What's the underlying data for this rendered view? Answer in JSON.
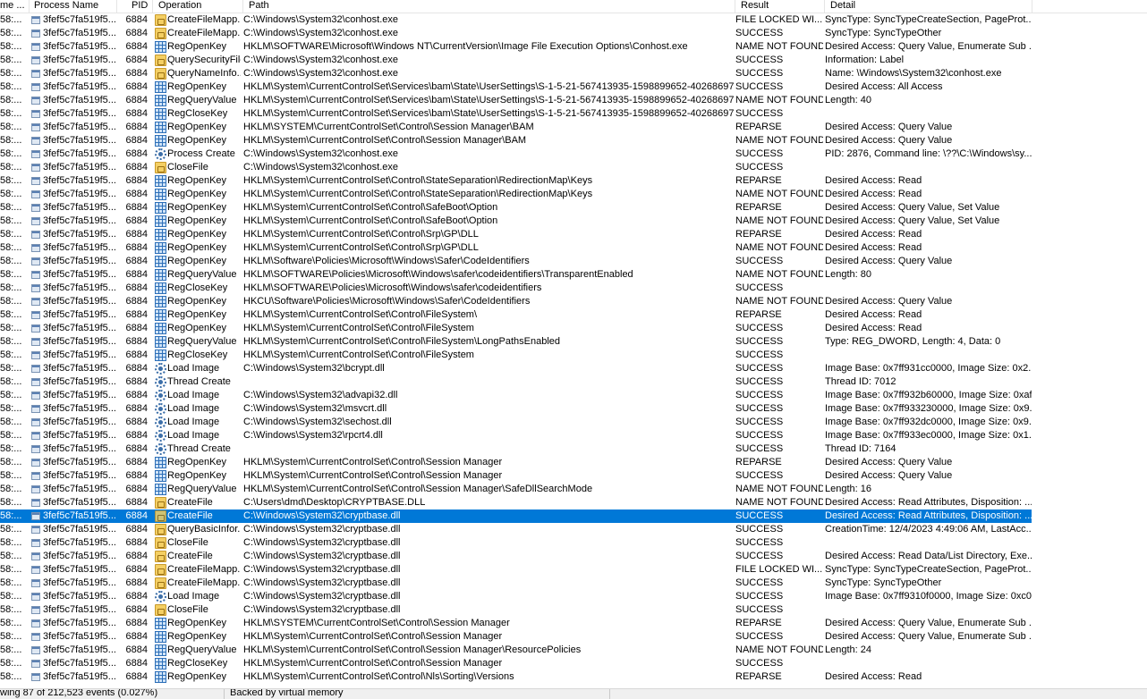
{
  "columns": {
    "time": "me ...",
    "process": "Process Name",
    "pid": "PID",
    "operation": "Operation",
    "path": "Path",
    "result": "Result",
    "detail": "Detail"
  },
  "rows": [
    {
      "time": "58:...",
      "process": "3fef5c7fa519f5...",
      "pid": "6884",
      "op_icon": "file-icon",
      "operation": "CreateFileMapp...",
      "path": "C:\\Windows\\System32\\conhost.exe",
      "result": "FILE LOCKED WI...",
      "detail": "SyncType: SyncTypeCreateSection, PageProt..."
    },
    {
      "time": "58:...",
      "process": "3fef5c7fa519f5...",
      "pid": "6884",
      "op_icon": "file-icon",
      "operation": "CreateFileMapp...",
      "path": "C:\\Windows\\System32\\conhost.exe",
      "result": "SUCCESS",
      "detail": "SyncType: SyncTypeOther"
    },
    {
      "time": "58:...",
      "process": "3fef5c7fa519f5...",
      "pid": "6884",
      "op_icon": "registry-icon",
      "operation": "RegOpenKey",
      "path": "HKLM\\SOFTWARE\\Microsoft\\Windows NT\\CurrentVersion\\Image File Execution Options\\Conhost.exe",
      "result": "NAME NOT FOUND",
      "detail": "Desired Access: Query Value, Enumerate Sub ..."
    },
    {
      "time": "58:...",
      "process": "3fef5c7fa519f5...",
      "pid": "6884",
      "op_icon": "file-icon",
      "operation": "QuerySecurityFile",
      "path": "C:\\Windows\\System32\\conhost.exe",
      "result": "SUCCESS",
      "detail": "Information: Label"
    },
    {
      "time": "58:...",
      "process": "3fef5c7fa519f5...",
      "pid": "6884",
      "op_icon": "file-icon",
      "operation": "QueryNameInfo...",
      "path": "C:\\Windows\\System32\\conhost.exe",
      "result": "SUCCESS",
      "detail": "Name: \\Windows\\System32\\conhost.exe"
    },
    {
      "time": "58:...",
      "process": "3fef5c7fa519f5...",
      "pid": "6884",
      "op_icon": "registry-icon",
      "operation": "RegOpenKey",
      "path": "HKLM\\System\\CurrentControlSet\\Services\\bam\\State\\UserSettings\\S-1-5-21-567413935-1598899652-40268697...",
      "result": "SUCCESS",
      "detail": "Desired Access: All Access"
    },
    {
      "time": "58:...",
      "process": "3fef5c7fa519f5...",
      "pid": "6884",
      "op_icon": "registry-icon",
      "operation": "RegQueryValue",
      "path": "HKLM\\System\\CurrentControlSet\\Services\\bam\\State\\UserSettings\\S-1-5-21-567413935-1598899652-40268697...",
      "result": "NAME NOT FOUND",
      "detail": "Length: 40"
    },
    {
      "time": "58:...",
      "process": "3fef5c7fa519f5...",
      "pid": "6884",
      "op_icon": "registry-icon",
      "operation": "RegCloseKey",
      "path": "HKLM\\System\\CurrentControlSet\\Services\\bam\\State\\UserSettings\\S-1-5-21-567413935-1598899652-40268697...",
      "result": "SUCCESS",
      "detail": ""
    },
    {
      "time": "58:...",
      "process": "3fef5c7fa519f5...",
      "pid": "6884",
      "op_icon": "registry-icon",
      "operation": "RegOpenKey",
      "path": "HKLM\\SYSTEM\\CurrentControlSet\\Control\\Session Manager\\BAM",
      "result": "REPARSE",
      "detail": "Desired Access: Query Value"
    },
    {
      "time": "58:...",
      "process": "3fef5c7fa519f5...",
      "pid": "6884",
      "op_icon": "registry-icon",
      "operation": "RegOpenKey",
      "path": "HKLM\\System\\CurrentControlSet\\Control\\Session Manager\\BAM",
      "result": "NAME NOT FOUND",
      "detail": "Desired Access: Query Value"
    },
    {
      "time": "58:...",
      "process": "3fef5c7fa519f5...",
      "pid": "6884",
      "op_icon": "process-icon",
      "operation": "Process Create",
      "path": "C:\\Windows\\System32\\conhost.exe",
      "result": "SUCCESS",
      "detail": "PID: 2876, Command line: \\??\\C:\\Windows\\sy..."
    },
    {
      "time": "58:...",
      "process": "3fef5c7fa519f5...",
      "pid": "6884",
      "op_icon": "file-icon",
      "operation": "CloseFile",
      "path": "C:\\Windows\\System32\\conhost.exe",
      "result": "SUCCESS",
      "detail": ""
    },
    {
      "time": "58:...",
      "process": "3fef5c7fa519f5...",
      "pid": "6884",
      "op_icon": "registry-icon",
      "operation": "RegOpenKey",
      "path": "HKLM\\System\\CurrentControlSet\\Control\\StateSeparation\\RedirectionMap\\Keys",
      "result": "REPARSE",
      "detail": "Desired Access: Read"
    },
    {
      "time": "58:...",
      "process": "3fef5c7fa519f5...",
      "pid": "6884",
      "op_icon": "registry-icon",
      "operation": "RegOpenKey",
      "path": "HKLM\\System\\CurrentControlSet\\Control\\StateSeparation\\RedirectionMap\\Keys",
      "result": "NAME NOT FOUND",
      "detail": "Desired Access: Read"
    },
    {
      "time": "58:...",
      "process": "3fef5c7fa519f5...",
      "pid": "6884",
      "op_icon": "registry-icon",
      "operation": "RegOpenKey",
      "path": "HKLM\\System\\CurrentControlSet\\Control\\SafeBoot\\Option",
      "result": "REPARSE",
      "detail": "Desired Access: Query Value, Set Value"
    },
    {
      "time": "58:...",
      "process": "3fef5c7fa519f5...",
      "pid": "6884",
      "op_icon": "registry-icon",
      "operation": "RegOpenKey",
      "path": "HKLM\\System\\CurrentControlSet\\Control\\SafeBoot\\Option",
      "result": "NAME NOT FOUND",
      "detail": "Desired Access: Query Value, Set Value"
    },
    {
      "time": "58:...",
      "process": "3fef5c7fa519f5...",
      "pid": "6884",
      "op_icon": "registry-icon",
      "operation": "RegOpenKey",
      "path": "HKLM\\System\\CurrentControlSet\\Control\\Srp\\GP\\DLL",
      "result": "REPARSE",
      "detail": "Desired Access: Read"
    },
    {
      "time": "58:...",
      "process": "3fef5c7fa519f5...",
      "pid": "6884",
      "op_icon": "registry-icon",
      "operation": "RegOpenKey",
      "path": "HKLM\\System\\CurrentControlSet\\Control\\Srp\\GP\\DLL",
      "result": "NAME NOT FOUND",
      "detail": "Desired Access: Read"
    },
    {
      "time": "58:...",
      "process": "3fef5c7fa519f5...",
      "pid": "6884",
      "op_icon": "registry-icon",
      "operation": "RegOpenKey",
      "path": "HKLM\\Software\\Policies\\Microsoft\\Windows\\Safer\\CodeIdentifiers",
      "result": "SUCCESS",
      "detail": "Desired Access: Query Value"
    },
    {
      "time": "58:...",
      "process": "3fef5c7fa519f5...",
      "pid": "6884",
      "op_icon": "registry-icon",
      "operation": "RegQueryValue",
      "path": "HKLM\\SOFTWARE\\Policies\\Microsoft\\Windows\\safer\\codeidentifiers\\TransparentEnabled",
      "result": "NAME NOT FOUND",
      "detail": "Length: 80"
    },
    {
      "time": "58:...",
      "process": "3fef5c7fa519f5...",
      "pid": "6884",
      "op_icon": "registry-icon",
      "operation": "RegCloseKey",
      "path": "HKLM\\SOFTWARE\\Policies\\Microsoft\\Windows\\safer\\codeidentifiers",
      "result": "SUCCESS",
      "detail": ""
    },
    {
      "time": "58:...",
      "process": "3fef5c7fa519f5...",
      "pid": "6884",
      "op_icon": "registry-icon",
      "operation": "RegOpenKey",
      "path": "HKCU\\Software\\Policies\\Microsoft\\Windows\\Safer\\CodeIdentifiers",
      "result": "NAME NOT FOUND",
      "detail": "Desired Access: Query Value"
    },
    {
      "time": "58:...",
      "process": "3fef5c7fa519f5...",
      "pid": "6884",
      "op_icon": "registry-icon",
      "operation": "RegOpenKey",
      "path": "HKLM\\System\\CurrentControlSet\\Control\\FileSystem\\",
      "result": "REPARSE",
      "detail": "Desired Access: Read"
    },
    {
      "time": "58:...",
      "process": "3fef5c7fa519f5...",
      "pid": "6884",
      "op_icon": "registry-icon",
      "operation": "RegOpenKey",
      "path": "HKLM\\System\\CurrentControlSet\\Control\\FileSystem",
      "result": "SUCCESS",
      "detail": "Desired Access: Read"
    },
    {
      "time": "58:...",
      "process": "3fef5c7fa519f5...",
      "pid": "6884",
      "op_icon": "registry-icon",
      "operation": "RegQueryValue",
      "path": "HKLM\\System\\CurrentControlSet\\Control\\FileSystem\\LongPathsEnabled",
      "result": "SUCCESS",
      "detail": "Type: REG_DWORD, Length: 4, Data: 0"
    },
    {
      "time": "58:...",
      "process": "3fef5c7fa519f5...",
      "pid": "6884",
      "op_icon": "registry-icon",
      "operation": "RegCloseKey",
      "path": "HKLM\\System\\CurrentControlSet\\Control\\FileSystem",
      "result": "SUCCESS",
      "detail": ""
    },
    {
      "time": "58:...",
      "process": "3fef5c7fa519f5...",
      "pid": "6884",
      "op_icon": "process-icon",
      "operation": "Load Image",
      "path": "C:\\Windows\\System32\\bcrypt.dll",
      "result": "SUCCESS",
      "detail": "Image Base: 0x7ff931cc0000, Image Size: 0x2..."
    },
    {
      "time": "58:...",
      "process": "3fef5c7fa519f5...",
      "pid": "6884",
      "op_icon": "process-icon",
      "operation": "Thread Create",
      "path": "",
      "result": "SUCCESS",
      "detail": "Thread ID: 7012"
    },
    {
      "time": "58:...",
      "process": "3fef5c7fa519f5...",
      "pid": "6884",
      "op_icon": "process-icon",
      "operation": "Load Image",
      "path": "C:\\Windows\\System32\\advapi32.dll",
      "result": "SUCCESS",
      "detail": "Image Base: 0x7ff932b60000, Image Size: 0xaf..."
    },
    {
      "time": "58:...",
      "process": "3fef5c7fa519f5...",
      "pid": "6884",
      "op_icon": "process-icon",
      "operation": "Load Image",
      "path": "C:\\Windows\\System32\\msvcrt.dll",
      "result": "SUCCESS",
      "detail": "Image Base: 0x7ff933230000, Image Size: 0x9..."
    },
    {
      "time": "58:...",
      "process": "3fef5c7fa519f5...",
      "pid": "6884",
      "op_icon": "process-icon",
      "operation": "Load Image",
      "path": "C:\\Windows\\System32\\sechost.dll",
      "result": "SUCCESS",
      "detail": "Image Base: 0x7ff932dc0000, Image Size: 0x9..."
    },
    {
      "time": "58:...",
      "process": "3fef5c7fa519f5...",
      "pid": "6884",
      "op_icon": "process-icon",
      "operation": "Load Image",
      "path": "C:\\Windows\\System32\\rpcrt4.dll",
      "result": "SUCCESS",
      "detail": "Image Base: 0x7ff933ec0000, Image Size: 0x1..."
    },
    {
      "time": "58:...",
      "process": "3fef5c7fa519f5...",
      "pid": "6884",
      "op_icon": "process-icon",
      "operation": "Thread Create",
      "path": "",
      "result": "SUCCESS",
      "detail": "Thread ID: 7164"
    },
    {
      "time": "58:...",
      "process": "3fef5c7fa519f5...",
      "pid": "6884",
      "op_icon": "registry-icon",
      "operation": "RegOpenKey",
      "path": "HKLM\\System\\CurrentControlSet\\Control\\Session Manager",
      "result": "REPARSE",
      "detail": "Desired Access: Query Value"
    },
    {
      "time": "58:...",
      "process": "3fef5c7fa519f5...",
      "pid": "6884",
      "op_icon": "registry-icon",
      "operation": "RegOpenKey",
      "path": "HKLM\\System\\CurrentControlSet\\Control\\Session Manager",
      "result": "SUCCESS",
      "detail": "Desired Access: Query Value"
    },
    {
      "time": "58:...",
      "process": "3fef5c7fa519f5...",
      "pid": "6884",
      "op_icon": "registry-icon",
      "operation": "RegQueryValue",
      "path": "HKLM\\System\\CurrentControlSet\\Control\\Session Manager\\SafeDllSearchMode",
      "result": "NAME NOT FOUND",
      "detail": "Length: 16"
    },
    {
      "time": "58:...",
      "process": "3fef5c7fa519f5...",
      "pid": "6884",
      "op_icon": "file-icon",
      "operation": "CreateFile",
      "path": "C:\\Users\\dmd\\Desktop\\CRYPTBASE.DLL",
      "result": "NAME NOT FOUND",
      "detail": "Desired Access: Read Attributes, Disposition: ..."
    },
    {
      "time": "58:...",
      "process": "3fef5c7fa519f5...",
      "pid": "6884",
      "op_icon": "file-icon",
      "operation": "CreateFile",
      "path": "C:\\Windows\\System32\\cryptbase.dll",
      "result": "SUCCESS",
      "detail": "Desired Access: Read Attributes, Disposition: ...",
      "selected": true
    },
    {
      "time": "58:...",
      "process": "3fef5c7fa519f5...",
      "pid": "6884",
      "op_icon": "file-icon",
      "operation": "QueryBasicInfor...",
      "path": "C:\\Windows\\System32\\cryptbase.dll",
      "result": "SUCCESS",
      "detail": "CreationTime: 12/4/2023 4:49:06 AM, LastAcc..."
    },
    {
      "time": "58:...",
      "process": "3fef5c7fa519f5...",
      "pid": "6884",
      "op_icon": "file-icon",
      "operation": "CloseFile",
      "path": "C:\\Windows\\System32\\cryptbase.dll",
      "result": "SUCCESS",
      "detail": ""
    },
    {
      "time": "58:...",
      "process": "3fef5c7fa519f5...",
      "pid": "6884",
      "op_icon": "file-icon",
      "operation": "CreateFile",
      "path": "C:\\Windows\\System32\\cryptbase.dll",
      "result": "SUCCESS",
      "detail": "Desired Access: Read Data/List Directory, Exe..."
    },
    {
      "time": "58:...",
      "process": "3fef5c7fa519f5...",
      "pid": "6884",
      "op_icon": "file-icon",
      "operation": "CreateFileMapp...",
      "path": "C:\\Windows\\System32\\cryptbase.dll",
      "result": "FILE LOCKED WI...",
      "detail": "SyncType: SyncTypeCreateSection, PageProt..."
    },
    {
      "time": "58:...",
      "process": "3fef5c7fa519f5...",
      "pid": "6884",
      "op_icon": "file-icon",
      "operation": "CreateFileMapp...",
      "path": "C:\\Windows\\System32\\cryptbase.dll",
      "result": "SUCCESS",
      "detail": "SyncType: SyncTypeOther"
    },
    {
      "time": "58:...",
      "process": "3fef5c7fa519f5...",
      "pid": "6884",
      "op_icon": "process-icon",
      "operation": "Load Image",
      "path": "C:\\Windows\\System32\\cryptbase.dll",
      "result": "SUCCESS",
      "detail": "Image Base: 0x7ff9310f0000, Image Size: 0xc0..."
    },
    {
      "time": "58:...",
      "process": "3fef5c7fa519f5...",
      "pid": "6884",
      "op_icon": "file-icon",
      "operation": "CloseFile",
      "path": "C:\\Windows\\System32\\cryptbase.dll",
      "result": "SUCCESS",
      "detail": ""
    },
    {
      "time": "58:...",
      "process": "3fef5c7fa519f5...",
      "pid": "6884",
      "op_icon": "registry-icon",
      "operation": "RegOpenKey",
      "path": "HKLM\\SYSTEM\\CurrentControlSet\\Control\\Session Manager",
      "result": "REPARSE",
      "detail": "Desired Access: Query Value, Enumerate Sub ..."
    },
    {
      "time": "58:...",
      "process": "3fef5c7fa519f5...",
      "pid": "6884",
      "op_icon": "registry-icon",
      "operation": "RegOpenKey",
      "path": "HKLM\\System\\CurrentControlSet\\Control\\Session Manager",
      "result": "SUCCESS",
      "detail": "Desired Access: Query Value, Enumerate Sub ..."
    },
    {
      "time": "58:...",
      "process": "3fef5c7fa519f5...",
      "pid": "6884",
      "op_icon": "registry-icon",
      "operation": "RegQueryValue",
      "path": "HKLM\\System\\CurrentControlSet\\Control\\Session Manager\\ResourcePolicies",
      "result": "NAME NOT FOUND",
      "detail": "Length: 24"
    },
    {
      "time": "58:...",
      "process": "3fef5c7fa519f5...",
      "pid": "6884",
      "op_icon": "registry-icon",
      "operation": "RegCloseKey",
      "path": "HKLM\\System\\CurrentControlSet\\Control\\Session Manager",
      "result": "SUCCESS",
      "detail": ""
    },
    {
      "time": "58:...",
      "process": "3fef5c7fa519f5...",
      "pid": "6884",
      "op_icon": "registry-icon",
      "operation": "RegOpenKey",
      "path": "HKLM\\System\\CurrentControlSet\\Control\\Nls\\Sorting\\Versions",
      "result": "REPARSE",
      "detail": "Desired Access: Read"
    }
  ],
  "status": {
    "events": "wing 87 of 212,523 events (0.027%)",
    "memory": "Backed by virtual memory"
  },
  "colors": {
    "selection": "#0078d7",
    "selection_text": "#ffffff",
    "file_icon": "#f4cf63",
    "registry_icon": "#2d6fb8",
    "process_icon": "#3b6ea8"
  }
}
